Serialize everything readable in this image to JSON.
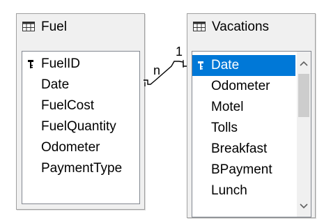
{
  "tables": [
    {
      "title": "Fuel",
      "fields": [
        {
          "name": "FuelID",
          "key": true
        },
        {
          "name": "Date",
          "key": false
        },
        {
          "name": "FuelCost",
          "key": false
        },
        {
          "name": "FuelQuantity",
          "key": false
        },
        {
          "name": "Odometer",
          "key": false
        },
        {
          "name": "PaymentType",
          "key": false
        }
      ]
    },
    {
      "title": "Vacations",
      "fields": [
        {
          "name": "Date",
          "key": true,
          "selected": true
        },
        {
          "name": "Odometer",
          "key": false
        },
        {
          "name": "Motel",
          "key": false
        },
        {
          "name": "Tolls",
          "key": false
        },
        {
          "name": "Breakfast",
          "key": false
        },
        {
          "name": "BPayment",
          "key": false
        },
        {
          "name": "Lunch",
          "key": false
        }
      ]
    }
  ],
  "relation": {
    "from_label": "n",
    "to_label": "1"
  },
  "colors": {
    "selection": "#0078d7",
    "window_bg": "#f0f0f0",
    "list_bg": "#ffffff"
  },
  "icons": {
    "table": "table-icon",
    "primary_key": "primary-key-icon",
    "scroll_up": "chevron-up-icon",
    "scroll_down": "chevron-down-icon"
  }
}
